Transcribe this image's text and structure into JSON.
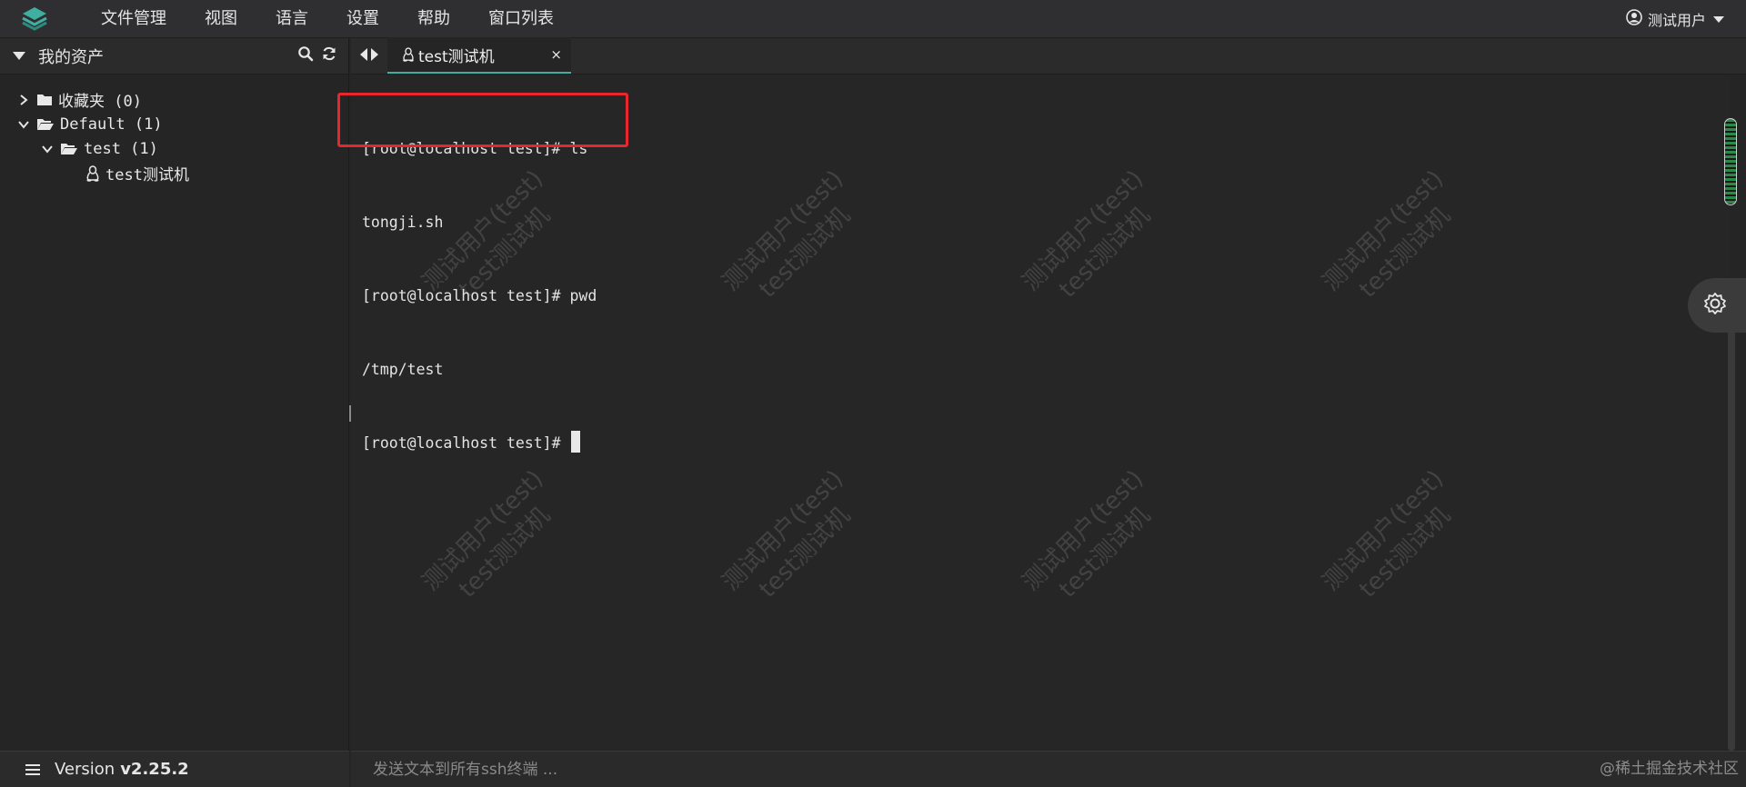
{
  "menubar": {
    "items": [
      {
        "label": "文件管理"
      },
      {
        "label": "视图"
      },
      {
        "label": "语言"
      },
      {
        "label": "设置"
      },
      {
        "label": "帮助"
      },
      {
        "label": "窗口列表"
      }
    ],
    "user": "测试用户"
  },
  "sidebar": {
    "title": "我的资产",
    "tree": [
      {
        "label": "收藏夹 (0)"
      },
      {
        "label": "Default (1)"
      },
      {
        "label": "test (1)"
      },
      {
        "label": "test测试机"
      }
    ],
    "version_prefix": "Version",
    "version": "v2.25.2"
  },
  "tabs": [
    {
      "label": "test测试机",
      "close": "×"
    }
  ],
  "terminal": {
    "lines": [
      "[root@localhost test]# ls",
      "tongji.sh",
      "[root@localhost test]# pwd",
      "/tmp/test",
      "[root@localhost test]# "
    ],
    "watermark_line1": "测试用户(test)",
    "watermark_line2": "test测试机"
  },
  "broadcast": {
    "placeholder": "发送文本到所有ssh终端 ..."
  },
  "footer_credit": "@稀土掘金技术社区",
  "colors": {
    "accent": "#3fb0a0",
    "highlight_box": "#e8262d",
    "background": "#262626"
  }
}
